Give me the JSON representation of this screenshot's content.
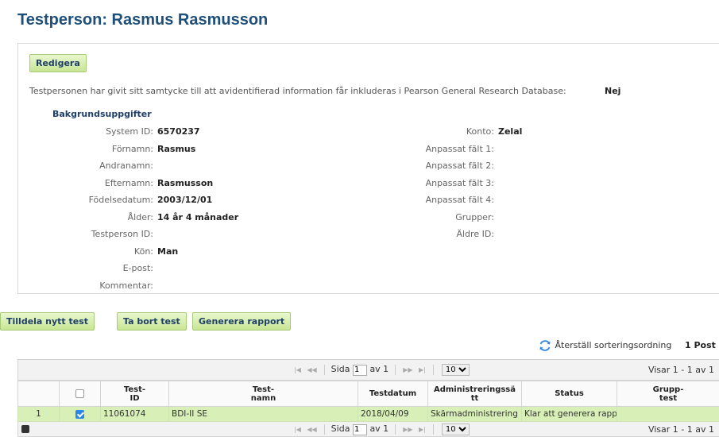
{
  "page": {
    "title": "Testperson: Rasmus Rasmusson"
  },
  "details": {
    "edit_label": "Redigera",
    "consent_text": "Testpersonen har givit sitt samtycke till att avidentifierad information får inkluderas i Pearson General Research Database:",
    "consent_value": "Nej",
    "section_title": "Bakgrundsuppgifter",
    "left_fields": [
      {
        "label": "System ID:",
        "value": "6570237"
      },
      {
        "label": "Förnamn:",
        "value": "Rasmus"
      },
      {
        "label": "Andranamn:",
        "value": ""
      },
      {
        "label": "Efternamn:",
        "value": "Rasmusson"
      },
      {
        "label": "Födelsedatum:",
        "value": "2003/12/01"
      },
      {
        "label": "Ålder:",
        "value": "14 år 4 månader"
      },
      {
        "label": "Testperson ID:",
        "value": ""
      },
      {
        "label": "Kön:",
        "value": "Man"
      },
      {
        "label": "E-post:",
        "value": ""
      },
      {
        "label": "Kommentar:",
        "value": ""
      }
    ],
    "right_fields": [
      {
        "label": "Konto:",
        "value": "Zelal"
      },
      {
        "label": "Anpassat fält 1:",
        "value": ""
      },
      {
        "label": "Anpassat fält 2:",
        "value": ""
      },
      {
        "label": "Anpassat fält 3:",
        "value": ""
      },
      {
        "label": "Anpassat fält 4:",
        "value": ""
      },
      {
        "label": "Grupper:",
        "value": ""
      },
      {
        "label": "Äldre ID:",
        "value": ""
      }
    ]
  },
  "actions": {
    "assign_label": "Tilldela nytt test",
    "remove_label": "Ta bort test",
    "report_label": "Generera rapport"
  },
  "grid": {
    "reset_sort_label": "Återställ sorteringsordning",
    "post_count": "1 Post",
    "pager": {
      "page_label": "Sida",
      "page_value": "1",
      "of_label": "av 1",
      "page_size": "10",
      "info": "Visar 1 - 1 av 1"
    },
    "columns": [
      "",
      "",
      "Test-\nID",
      "Test-\nnamn",
      "Testdatum",
      "Administreringssä\ntt",
      "Status",
      "Grupp-\ntest"
    ],
    "rows": [
      {
        "num": "1",
        "checked": true,
        "test_id": "11061074",
        "test_name": "BDI-II SE",
        "date": "2018/04/09",
        "admin": "Skärmadministrering",
        "status": "Klar att generera rapp",
        "group": ""
      }
    ]
  },
  "colors": {
    "title": "#1f4e79",
    "button_bg": "#c7e693",
    "selected_row": "#d8f0b8",
    "checkbox": "#2b86e8"
  }
}
